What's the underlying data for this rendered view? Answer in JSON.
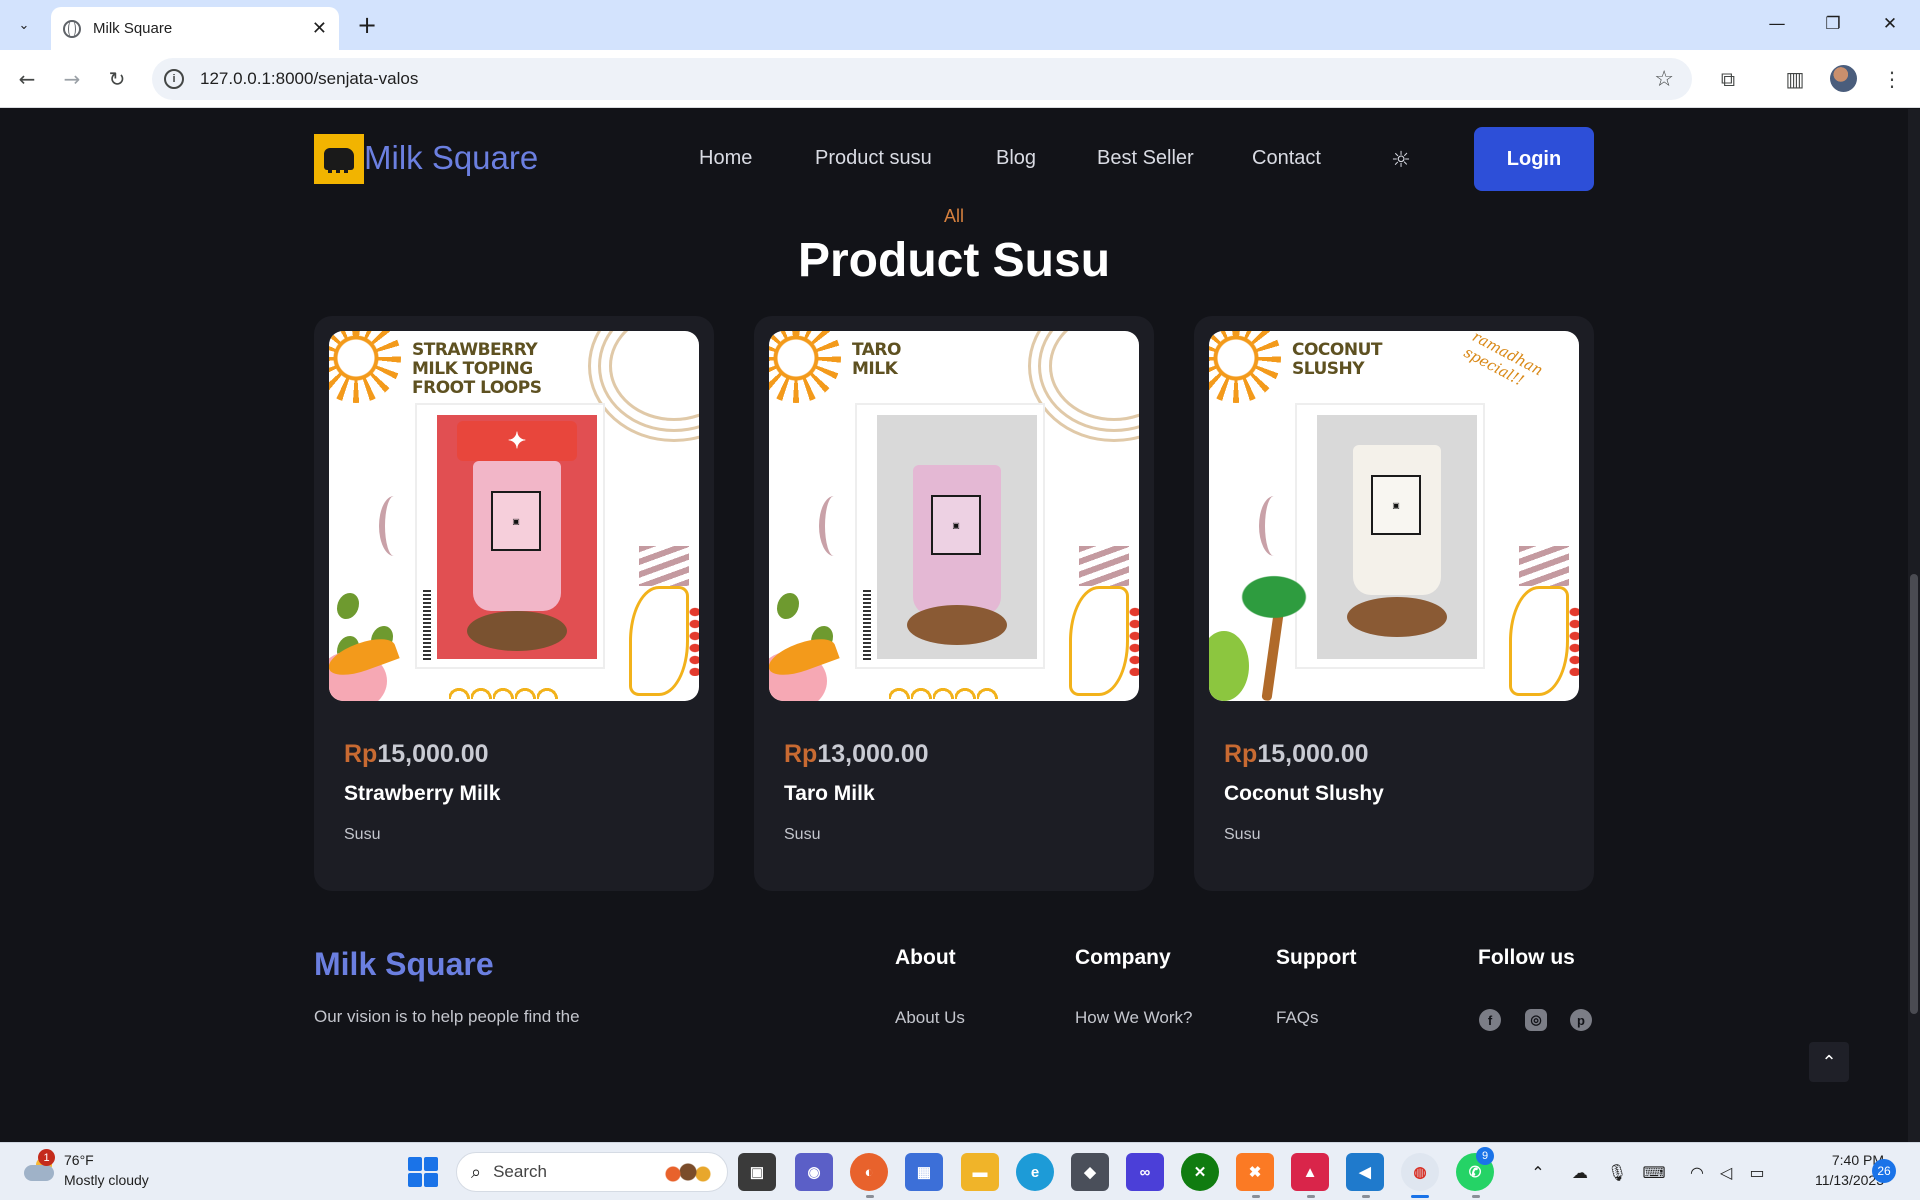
{
  "browser": {
    "tab_title": "Milk Square",
    "url": "127.0.0.1:8000/senjata-valos"
  },
  "site": {
    "brand": "Milk Square",
    "nav": [
      "Home",
      "Product susu",
      "Blog",
      "Best Seller",
      "Contact"
    ],
    "login_label": "Login"
  },
  "section": {
    "eyebrow": "All",
    "title": "Product Susu"
  },
  "products": [
    {
      "image_title": "STRAWBERRY MILK TOPING FROOT LOOPS",
      "currency": "Rp",
      "price": "15,000.00",
      "name": "Strawberry Milk",
      "category": "Susu",
      "cup_color": "#f2b6c8"
    },
    {
      "image_title": "TARO MILK",
      "currency": "Rp",
      "price": "13,000.00",
      "name": "Taro Milk",
      "category": "Susu",
      "cup_color": "#e4b8d4"
    },
    {
      "image_title": "COCONUT SLUSHY",
      "image_note": "ramadhan special!!",
      "currency": "Rp",
      "price": "15,000.00",
      "name": "Coconut Slushy",
      "category": "Susu",
      "cup_color": "#f4f1ea"
    }
  ],
  "footer": {
    "brand": "Milk Square",
    "vision": "Our vision is to help people find the",
    "columns": [
      {
        "title": "About",
        "first_link": "About Us"
      },
      {
        "title": "Company",
        "first_link": "How We Work?"
      },
      {
        "title": "Support",
        "first_link": "FAQs"
      },
      {
        "title": "Follow us",
        "first_link": ""
      }
    ],
    "social_icons": [
      "facebook-icon",
      "instagram-icon",
      "pinterest-icon"
    ]
  },
  "taskbar": {
    "weather_temp": "76°F",
    "weather_desc": "Mostly cloudy",
    "weather_badge": "1",
    "search_placeholder": "Search",
    "whatsapp_badge": "9",
    "time": "7:40 PM",
    "date": "11/13/2023",
    "notification_count": "26"
  },
  "colors": {
    "accent_brand": "#6b7fe0",
    "login_button": "#2d4fd8",
    "price_currency": "#c86a32",
    "page_background": "#121318",
    "card_background": "#1c1d24"
  }
}
